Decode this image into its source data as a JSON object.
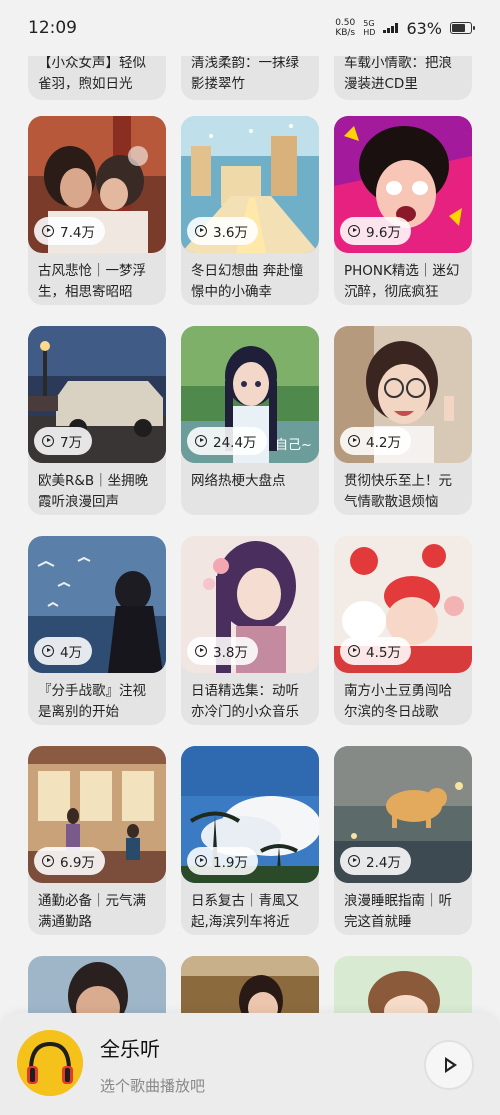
{
  "status_bar": {
    "time": "12:09",
    "net_speed_value": "0.50",
    "net_speed_unit": "KB/s",
    "net_type_top": "5G",
    "net_type_bottom": "HD",
    "battery_percent": "63%",
    "battery_level": 0.63
  },
  "top_row": [
    {
      "title": "【小众女声】轻似雀羽，煦如日光"
    },
    {
      "title": "清浅柔韵：一抹绿影搂翠竹"
    },
    {
      "title": "车载小情歌：把浪漫装进CD里"
    }
  ],
  "playlists": [
    {
      "plays": "7.4万",
      "title": "古风悲怆｜一梦浮生，相思寄昭昭"
    },
    {
      "plays": "3.6万",
      "title": "冬日幻想曲 奔赴憧憬中的小确幸"
    },
    {
      "plays": "9.6万",
      "title": "PHONK精选｜迷幻沉醉，彻底疯狂"
    },
    {
      "plays": "7万",
      "title": "欧美R&B｜坐拥晚霞听浪漫回声"
    },
    {
      "plays": "24.4万",
      "title": "网络热梗大盘点"
    },
    {
      "plays": "4.2万",
      "title": "贯彻快乐至上！元气情歌散退烦恼"
    },
    {
      "plays": "4万",
      "title": "『分手战歌』注视是离别的开始"
    },
    {
      "plays": "3.8万",
      "title": "日语精选集：动听亦冷门的小众音乐"
    },
    {
      "plays": "4.5万",
      "title": "南方小土豆勇闯哈尔滨的冬日战歌"
    },
    {
      "plays": "6.9万",
      "title": "通勤必备｜元气满满通勤路"
    },
    {
      "plays": "1.9万",
      "title": "日系复古｜青風又起,海滨列车将近"
    },
    {
      "plays": "2.4万",
      "title": "浪漫睡眠指南｜听完这首就睡"
    }
  ],
  "cover_text": {
    "overlay_fragment": "自己~"
  },
  "player": {
    "title": "全乐听",
    "subtitle": "选个歌曲播放吧"
  }
}
